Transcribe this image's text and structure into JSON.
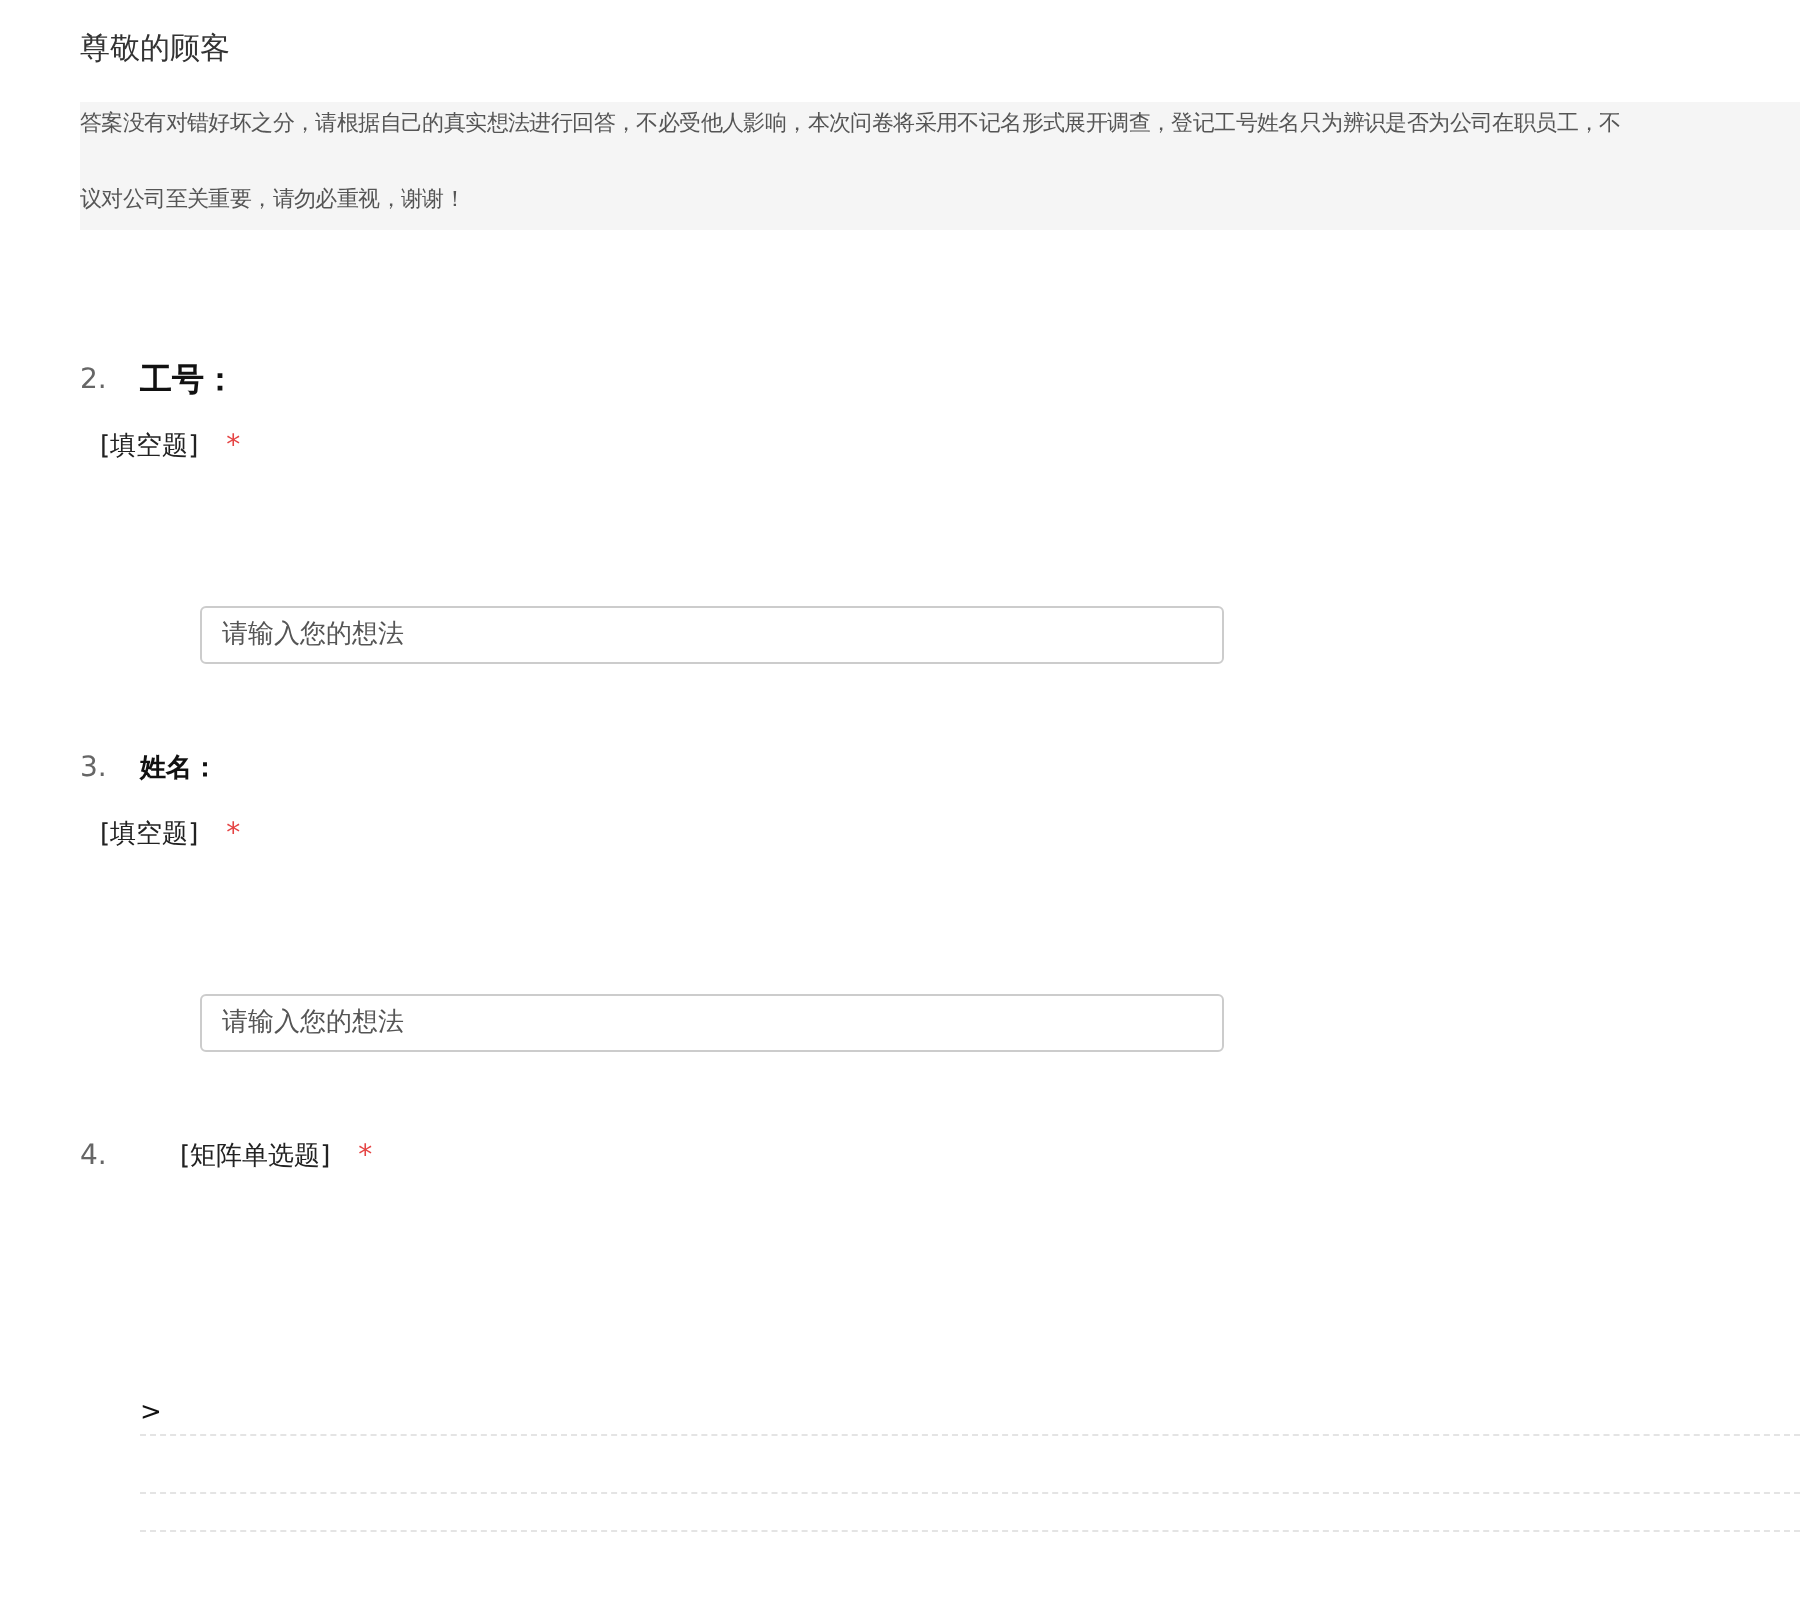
{
  "greeting": "尊敬的顾客",
  "intro_lines": [
    "答案没有对错好坏之分，请根据自己的真实想法进行回答，不必受他人影响，本次问卷将采用不记名形式展开调查，登记工号姓名只为辨识是否为公司在职员工，不",
    "议对公司至关重要，请勿必重视，谢谢！"
  ],
  "questions": [
    {
      "kind": "text",
      "number": "2.",
      "title": "工号：",
      "heading": true,
      "type_label": "[填空题]",
      "required_mark": "*",
      "placeholder": "请输入您的想法"
    },
    {
      "kind": "text",
      "number": "3.",
      "title": "姓名：",
      "heading": false,
      "type_label": "[填空题]",
      "required_mark": "*",
      "placeholder": "请输入您的想法"
    },
    {
      "kind": "matrix",
      "number": "4.",
      "type_label": "[矩阵单选题]",
      "required_mark": "*",
      "marker": ">"
    }
  ]
}
